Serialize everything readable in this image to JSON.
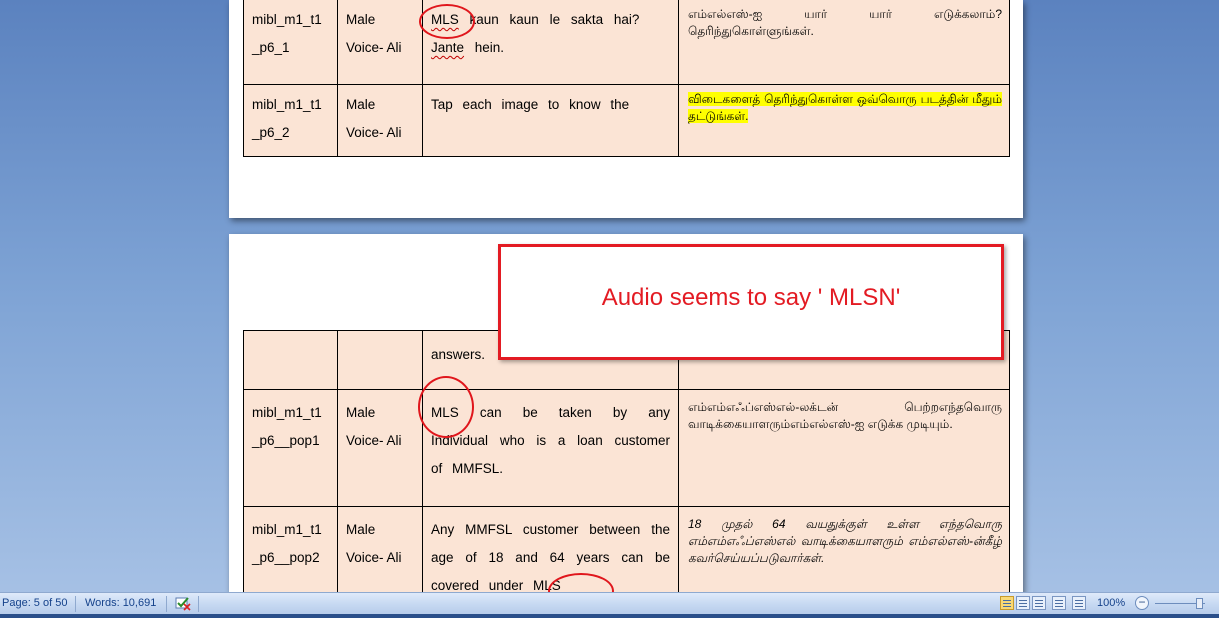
{
  "document": {
    "page1_rows": [
      {
        "id": "mibl_m1_t1 _p6_1",
        "id_l1": "mibl_m1_t1",
        "id_l2": "_p6_1",
        "voice_l1": "Male",
        "voice_l2": "Voice- Ali",
        "text_parts": [
          "MLS",
          " kaun kaun le sakta hai?",
          "Jante",
          " hein."
        ],
        "tamil": "எம்எல்எஸ்-ஐ யார் யார் எடுக்கலாம்? தெரிந்துகொள்ளுங்கள்."
      },
      {
        "id_l1": "mibl_m1_t1",
        "id_l2": "_p6_2",
        "voice_l1": "Male",
        "voice_l2": "Voice- Ali",
        "text": "Tap each image to know the",
        "tamil": "விடைகளைத் தெரிந்துகொள்ள ஒவ்வொரு படத்தின் மீதும் தட்டுங்கள்."
      }
    ],
    "page2_rows": [
      {
        "text": "answers."
      },
      {
        "id_l1": "mibl_m1_t1",
        "id_l2": "_p6__pop1",
        "voice_l1": "Male",
        "voice_l2": "Voice- Ali",
        "text": "MLS can be taken by any Individual who is a loan customer of MMFSL.",
        "tamil": "எம்எம்எஃப்எஸ்எல்-லக்டன் பெற்றஎந்தவொரு வாடிக்கையாளரும்எம்எல்எஸ்-ஐ எடுக்க முடியும்."
      },
      {
        "id_l1": "mibl_m1_t1",
        "id_l2": "_p6__pop2",
        "voice_l1": "Male",
        "voice_l2": "Voice- Ali",
        "text": "Any MMFSL customer between the age of 18 and 64 years can be covered under MLS",
        "tamil": "18 முதல் 64 வயதுக்குள் உள்ள எந்தவொரு எம்எம்எஃப்எஸ்எல் வாடிக்கையாளரும் எம்எல்எஸ்-ன்கீழ் கவர்செய்யப்படுவார்கள்."
      }
    ]
  },
  "comment": {
    "text": "Audio seems to say ' MLSN'",
    "color": "#e31b23"
  },
  "statusbar": {
    "page": "Page: 5 of 50",
    "words": "Words: 10,691",
    "zoom": "100%",
    "proofing_icon": "proofing-check-icon",
    "view_icons": [
      "print-layout-icon",
      "full-screen-reading-icon",
      "web-layout-icon",
      "outline-icon",
      "draft-icon"
    ]
  }
}
